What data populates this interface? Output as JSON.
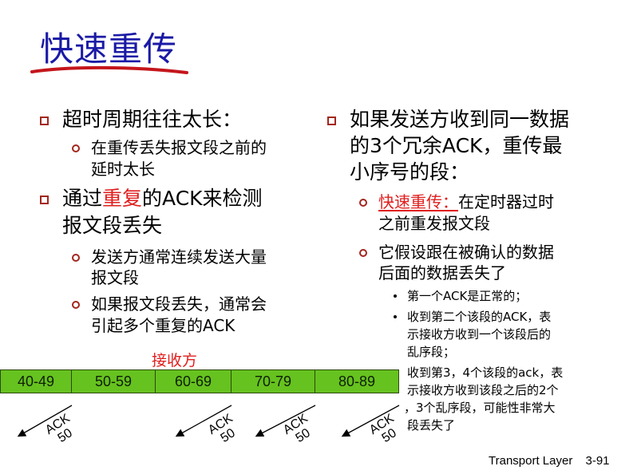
{
  "title": "快速重传",
  "left": {
    "b1": "超时周期往往太长：",
    "b1_sub1_l1": "在重传丢失报文段之前的",
    "b1_sub1_l2": "延时太长",
    "b2_pre": "通过",
    "b2_red": "重复",
    "b2_post": "的ACK来检测",
    "b2_l2": "报文段丢失",
    "b2_sub1_l1": "发送方通常连续发送大量",
    "b2_sub1_l2": "报文段",
    "b2_sub2_l1": "如果报文段丢失，通常会",
    "b2_sub2_l2": "引起多个重复的ACK"
  },
  "right": {
    "b1_l1": "如果发送方收到同一数据",
    "b1_l2": "的3个冗余ACK，重传最",
    "b1_l3": "小序号的段：",
    "sub1_red": "快速重传：",
    "sub1_rest": "在定时器过时",
    "sub1_l2": "之前重发报文段",
    "sub2_l1": "它假设跟在被确认的数据",
    "sub2_l2": "后面的数据丢失了",
    "d1": "第一个ACK是正常的；",
    "d2_l1": "收到第二个该段的ACK，表",
    "d2_l2": "示接收方收到一个该段后的",
    "d2_l3": "乱序段；",
    "d3_l1": "收到第3，4个该段的ack，表",
    "d3_l2": "示接收方收到该段之后的2个",
    "d3_l3": "，3个乱序段，可能性非常大",
    "d3_l4": "段丢失了"
  },
  "diagram": {
    "receiver_label": "接收方",
    "segments": [
      "40-49",
      "50-59",
      "60-69",
      "70-79",
      "80-89"
    ],
    "acks": [
      {
        "ack": "ACK",
        "num": "50"
      },
      {
        "ack": "ACK",
        "num": "50"
      },
      {
        "ack": "ACK",
        "num": "50"
      },
      {
        "ack": "ACK",
        "num": "50"
      }
    ],
    "segment_color": "#66c21f"
  },
  "footer": {
    "course": "Transport Layer",
    "page": "3-91"
  }
}
